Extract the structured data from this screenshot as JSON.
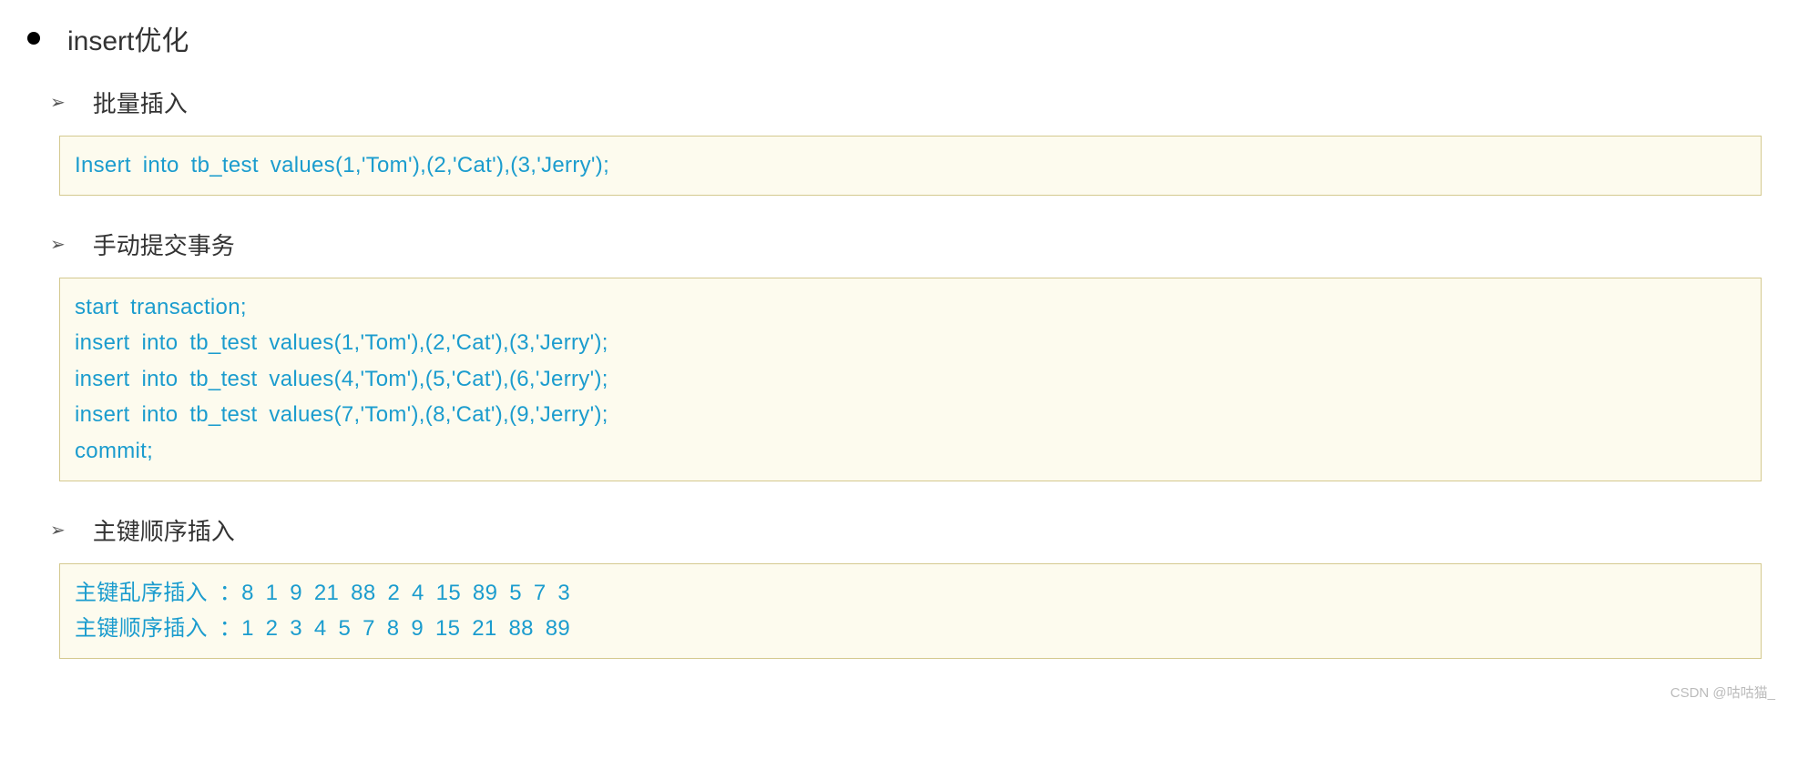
{
  "title": "insert优化",
  "sections": [
    {
      "heading": "批量插入",
      "lines": [
        "Insert into tb_test values(1,'Tom'),(2,'Cat'),(3,'Jerry');"
      ]
    },
    {
      "heading": "手动提交事务",
      "lines": [
        "start transaction;",
        "insert into tb_test values(1,'Tom'),(2,'Cat'),(3,'Jerry');",
        "insert into tb_test values(4,'Tom'),(5,'Cat'),(6,'Jerry');",
        "insert into tb_test values(7,'Tom'),(8,'Cat'),(9,'Jerry');",
        "commit;"
      ]
    },
    {
      "heading": "主键顺序插入",
      "lines": [
        "主键乱序插入 ：8   1   9   21   88   2   4   15   89   5   7   3",
        "主键顺序插入 ：1   2   3   4   5   7   8   9   15   21   88   89"
      ]
    }
  ],
  "watermark": "CSDN @咕咕猫_"
}
